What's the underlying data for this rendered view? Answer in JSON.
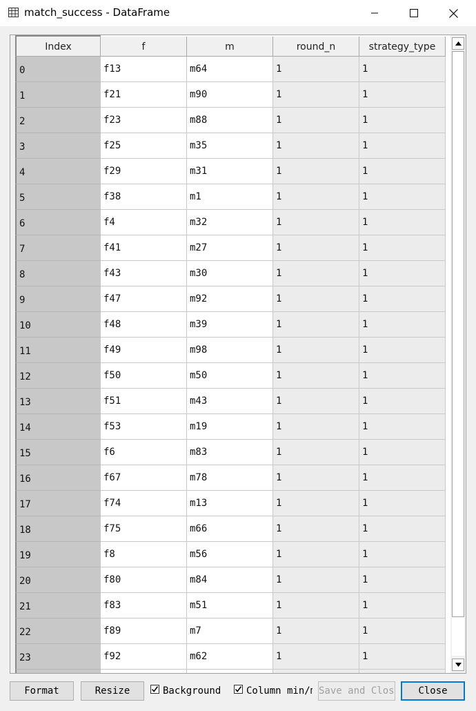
{
  "window": {
    "title": "match_success - DataFrame",
    "icon": "table-icon",
    "controls": [
      "minimize-icon",
      "maximize-icon",
      "close-icon"
    ]
  },
  "table": {
    "columns": [
      "Index",
      "f",
      "m",
      "round_n",
      "strategy_type"
    ],
    "rows": [
      {
        "index": "0",
        "f": "f13",
        "m": "m64",
        "round_n": "1",
        "strategy_type": "1"
      },
      {
        "index": "1",
        "f": "f21",
        "m": "m90",
        "round_n": "1",
        "strategy_type": "1"
      },
      {
        "index": "2",
        "f": "f23",
        "m": "m88",
        "round_n": "1",
        "strategy_type": "1"
      },
      {
        "index": "3",
        "f": "f25",
        "m": "m35",
        "round_n": "1",
        "strategy_type": "1"
      },
      {
        "index": "4",
        "f": "f29",
        "m": "m31",
        "round_n": "1",
        "strategy_type": "1"
      },
      {
        "index": "5",
        "f": "f38",
        "m": "m1",
        "round_n": "1",
        "strategy_type": "1"
      },
      {
        "index": "6",
        "f": "f4",
        "m": "m32",
        "round_n": "1",
        "strategy_type": "1"
      },
      {
        "index": "7",
        "f": "f41",
        "m": "m27",
        "round_n": "1",
        "strategy_type": "1"
      },
      {
        "index": "8",
        "f": "f43",
        "m": "m30",
        "round_n": "1",
        "strategy_type": "1"
      },
      {
        "index": "9",
        "f": "f47",
        "m": "m92",
        "round_n": "1",
        "strategy_type": "1"
      },
      {
        "index": "10",
        "f": "f48",
        "m": "m39",
        "round_n": "1",
        "strategy_type": "1"
      },
      {
        "index": "11",
        "f": "f49",
        "m": "m98",
        "round_n": "1",
        "strategy_type": "1"
      },
      {
        "index": "12",
        "f": "f50",
        "m": "m50",
        "round_n": "1",
        "strategy_type": "1"
      },
      {
        "index": "13",
        "f": "f51",
        "m": "m43",
        "round_n": "1",
        "strategy_type": "1"
      },
      {
        "index": "14",
        "f": "f53",
        "m": "m19",
        "round_n": "1",
        "strategy_type": "1"
      },
      {
        "index": "15",
        "f": "f6",
        "m": "m83",
        "round_n": "1",
        "strategy_type": "1"
      },
      {
        "index": "16",
        "f": "f67",
        "m": "m78",
        "round_n": "1",
        "strategy_type": "1"
      },
      {
        "index": "17",
        "f": "f74",
        "m": "m13",
        "round_n": "1",
        "strategy_type": "1"
      },
      {
        "index": "18",
        "f": "f75",
        "m": "m66",
        "round_n": "1",
        "strategy_type": "1"
      },
      {
        "index": "19",
        "f": "f8",
        "m": "m56",
        "round_n": "1",
        "strategy_type": "1"
      },
      {
        "index": "20",
        "f": "f80",
        "m": "m84",
        "round_n": "1",
        "strategy_type": "1"
      },
      {
        "index": "21",
        "f": "f83",
        "m": "m51",
        "round_n": "1",
        "strategy_type": "1"
      },
      {
        "index": "22",
        "f": "f89",
        "m": "m7",
        "round_n": "1",
        "strategy_type": "1"
      },
      {
        "index": "23",
        "f": "f92",
        "m": "m62",
        "round_n": "1",
        "strategy_type": "1"
      }
    ]
  },
  "toolbar": {
    "format_label": "Format",
    "resize_label": "Resize",
    "background_label": "Background c",
    "background_checked": true,
    "column_minmax_label": "Column min/m",
    "column_minmax_checked": true,
    "save_close_label": "Save and Close",
    "close_label": "Close"
  },
  "colors": {
    "index_bg": "#c8c8c8",
    "string_bg": "#ffffff",
    "numeric_bg": "#ececec",
    "focus_border": "#0078d7"
  }
}
